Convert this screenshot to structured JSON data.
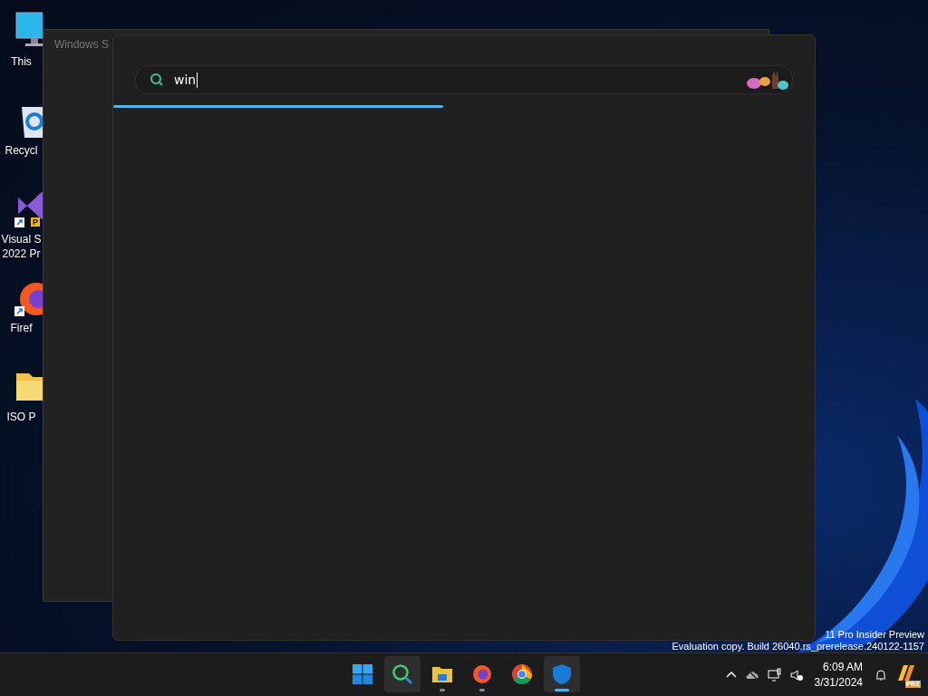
{
  "desktop_icons": [
    {
      "kind": "monitor",
      "lines": [
        "This"
      ]
    },
    {
      "kind": "recycle-bin",
      "lines": [
        "Recycl"
      ]
    },
    {
      "kind": "visual-studio",
      "lines": [
        "Visual S",
        "2022 Pr"
      ],
      "shortcut": true,
      "badge": "P"
    },
    {
      "kind": "firefox",
      "lines": [
        "Firef"
      ],
      "shortcut": true
    },
    {
      "kind": "folder",
      "lines": [
        "ISO P"
      ]
    }
  ],
  "background_window": {
    "title": "Windows S"
  },
  "search_window": {
    "query": "win",
    "progress": {
      "level": 0.47
    }
  },
  "system_watermark": [
    "11 Pro Insider Preview",
    "Evaluation copy. Build 26040.rs_prerelease.240122-1157"
  ],
  "taskbar": {
    "apps": [
      {
        "kind": "start",
        "running": false,
        "active": false,
        "hovered": false
      },
      {
        "kind": "search-app",
        "running": false,
        "active": false,
        "hovered": true
      },
      {
        "kind": "explorer",
        "running": true,
        "active": false,
        "hovered": false
      },
      {
        "kind": "firefox",
        "running": true,
        "active": false,
        "hovered": false
      },
      {
        "kind": "chrome",
        "running": false,
        "active": false,
        "hovered": false
      },
      {
        "kind": "defender",
        "running": true,
        "active": true,
        "hovered": false
      }
    ],
    "time": "6:09 AM",
    "date": "3/31/2024",
    "copilot_badge": "PRE"
  }
}
